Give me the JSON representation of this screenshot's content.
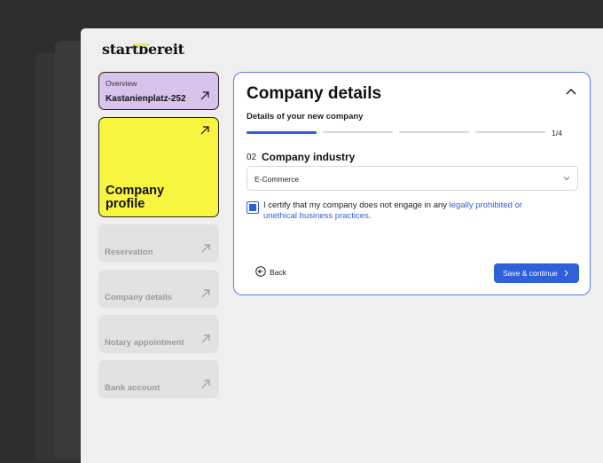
{
  "brand": {
    "logo_text": "startbereit",
    "accent": "#e9e94a"
  },
  "sidebar": {
    "overview": {
      "small_label": "Overview",
      "address": "Kastanienplatz-252",
      "color": "#d7c3ec"
    },
    "active": {
      "label": "Company profile",
      "color": "#f8f541"
    },
    "items": [
      {
        "label": "Reservation"
      },
      {
        "label": "Company details"
      },
      {
        "label": "Notary appointment"
      },
      {
        "label": "Bank account"
      }
    ]
  },
  "panel": {
    "title": "Company details",
    "subtitle": "Details of your new company",
    "progress": {
      "current": 1,
      "total": 4,
      "label": "1/4"
    },
    "question": {
      "number": "02",
      "title": "Company industry"
    },
    "select": {
      "value": "E-Commerce"
    },
    "certify": {
      "checked": true,
      "text_before": "I certify that my company does not engage in any ",
      "link_text": "legally prohibited or unethical business practices."
    },
    "back_label": "Back",
    "save_label": "Save & continue",
    "accent": "#2f5fd9"
  }
}
